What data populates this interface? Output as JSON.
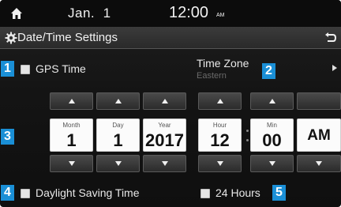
{
  "status_bar": {
    "date": "Jan.  1",
    "time": "12:00",
    "ampm": "AM"
  },
  "title_bar": {
    "title": "Date/Time Settings",
    "icon": "gear-icon",
    "back_icon": "back-icon"
  },
  "callouts": [
    "1",
    "2",
    "3",
    "4",
    "5"
  ],
  "gps_time": {
    "label": "GPS Time",
    "checked": false
  },
  "time_zone": {
    "label": "Time Zone",
    "value": "Eastern"
  },
  "fields": {
    "month": {
      "label": "Month",
      "value": "1"
    },
    "day": {
      "label": "Day",
      "value": "1"
    },
    "year": {
      "label": "Year",
      "value": "2017"
    },
    "hour": {
      "label": "Hour",
      "value": "12"
    },
    "min": {
      "label": "Min",
      "value": "00"
    },
    "ampm": {
      "value": "AM"
    }
  },
  "daylight_saving": {
    "label": "Daylight Saving Time",
    "checked": false
  },
  "hours_24": {
    "label": "24 Hours",
    "checked": false
  },
  "colors": {
    "accent": "#1a8fd6",
    "background": "#141414",
    "field": "#fbfbfb"
  }
}
